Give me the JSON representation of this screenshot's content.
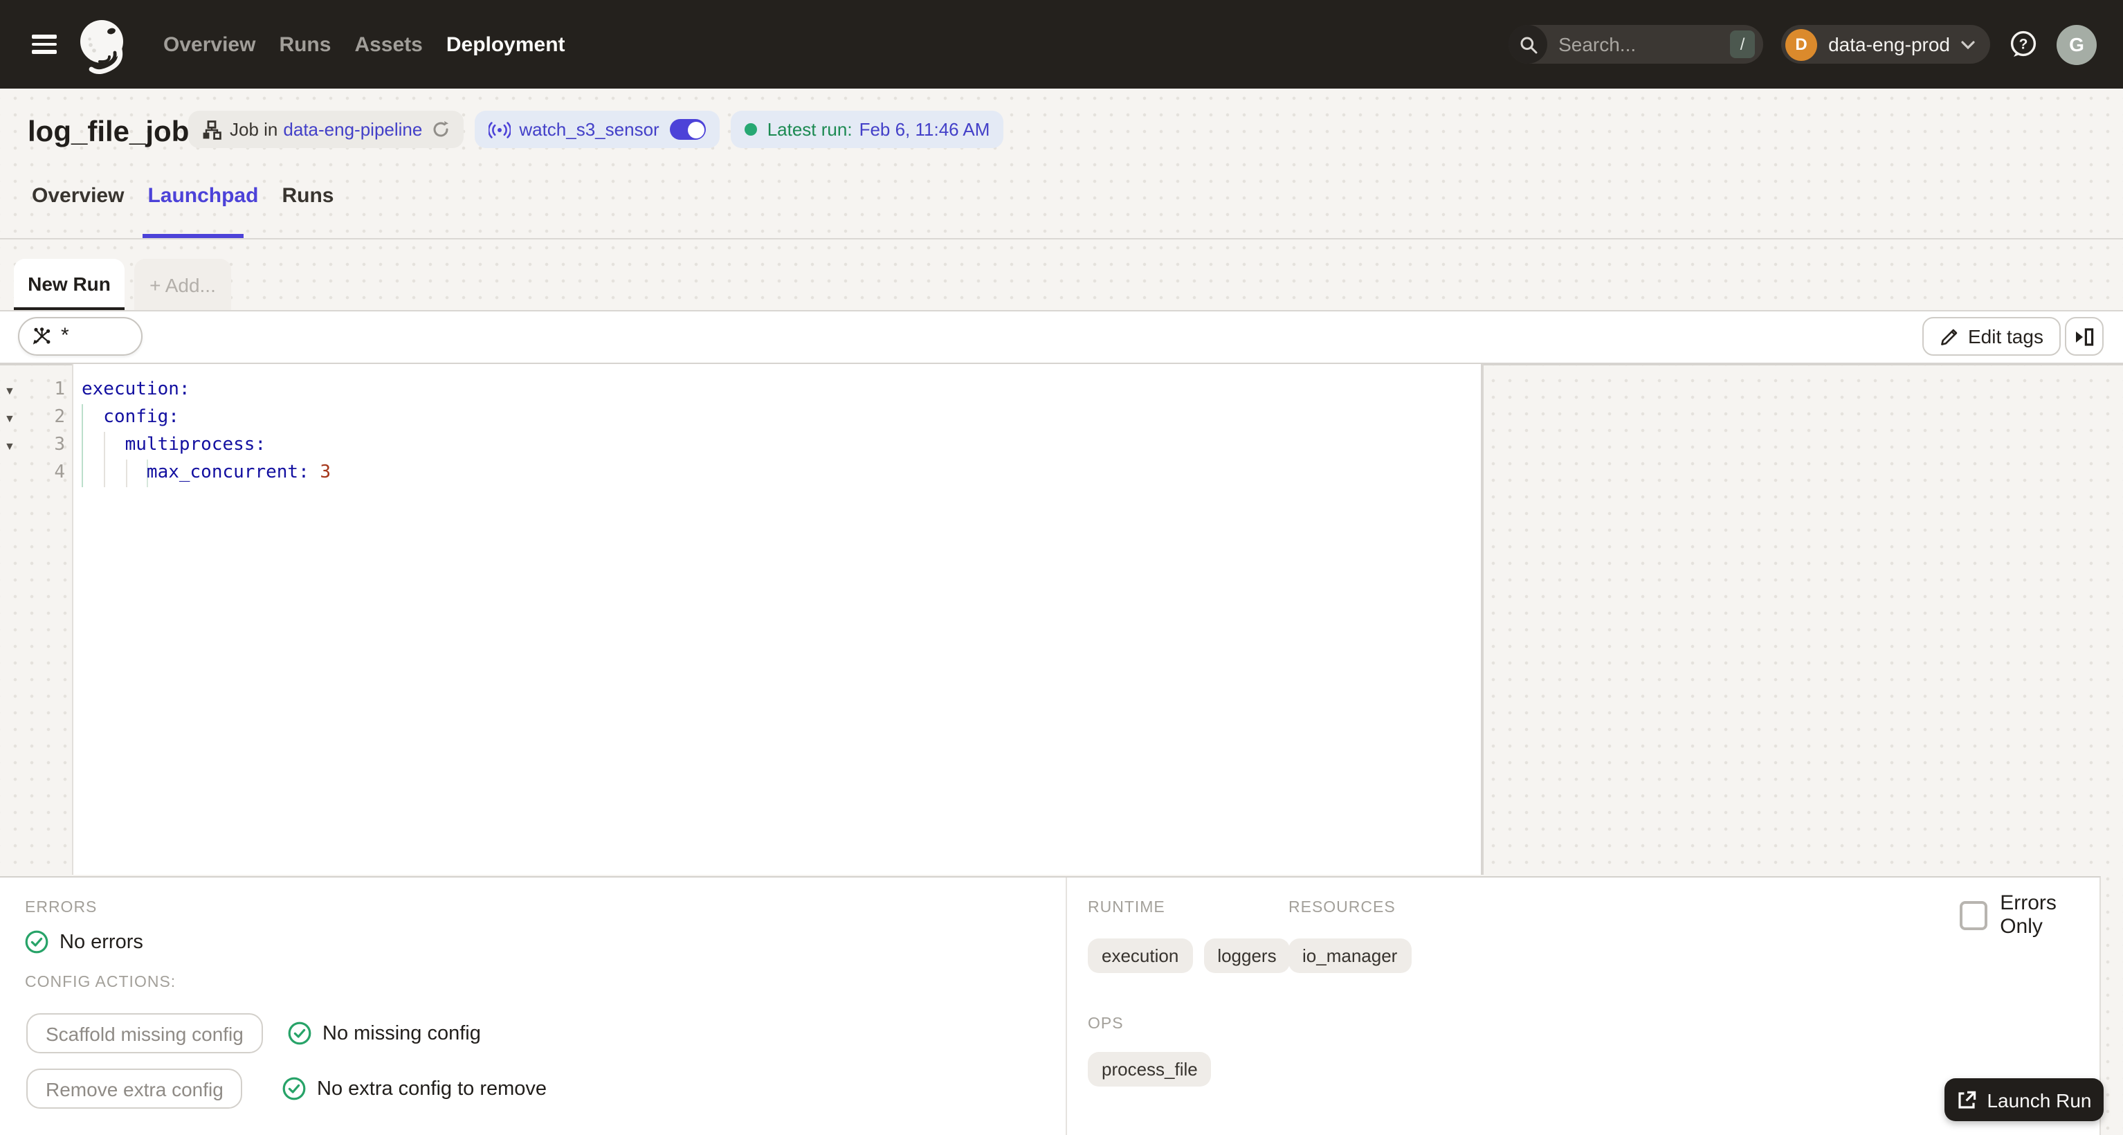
{
  "nav": {
    "items": [
      {
        "label": "Overview"
      },
      {
        "label": "Runs"
      },
      {
        "label": "Assets"
      },
      {
        "label": "Deployment"
      }
    ],
    "search": {
      "placeholder": "Search...",
      "shortcut": "/"
    },
    "workspace": {
      "initial": "D",
      "name": "data-eng-prod"
    },
    "user_initial": "G"
  },
  "header": {
    "title": "log_file_job",
    "job": {
      "prefix": "Job in",
      "repo": "data-eng-pipeline"
    },
    "sensor": {
      "name": "watch_s3_sensor"
    },
    "latest": {
      "label": "Latest run:",
      "value": "Feb 6, 11:46 AM"
    }
  },
  "tabs": [
    {
      "label": "Overview"
    },
    {
      "label": "Launchpad"
    },
    {
      "label": "Runs"
    }
  ],
  "session": {
    "active_tab": "New Run",
    "add_tab": "+ Add..."
  },
  "toolbar": {
    "op_selector_value": "*",
    "edit_tags_label": "Edit tags"
  },
  "editor": {
    "lines": [
      {
        "num": "1",
        "key": "execution:",
        "value": ""
      },
      {
        "num": "2",
        "key": "  config:",
        "value": ""
      },
      {
        "num": "3",
        "key": "    multiprocess:",
        "value": ""
      },
      {
        "num": "4",
        "key": "      max_concurrent: ",
        "value": "3"
      }
    ]
  },
  "preview": {
    "errors_label": "ERRORS",
    "no_errors": "No errors",
    "config_actions_label": "CONFIG ACTIONS:",
    "scaffold_button": "Scaffold missing config",
    "no_missing": "No missing config",
    "remove_button": "Remove extra config",
    "no_extra": "No extra config to remove",
    "errors_only_label": "Errors Only",
    "runtime_label": "RUNTIME",
    "resources_label": "RESOURCES",
    "ops_label": "OPS",
    "runtime_tags": [
      "execution",
      "loggers"
    ],
    "resource_tags": [
      "io_manager"
    ],
    "op_tags": [
      "process_file"
    ]
  },
  "launch": {
    "label": "Launch Run"
  },
  "colors": {
    "navbar": "#24211D",
    "accent": "#4C42D8",
    "link": "#4340C8",
    "green": "#27A873",
    "green_text": "#1C8A52",
    "yaml_key": "#120FA0",
    "yaml_number": "#A5371B",
    "workspace_avatar": "#DB8A2C"
  }
}
